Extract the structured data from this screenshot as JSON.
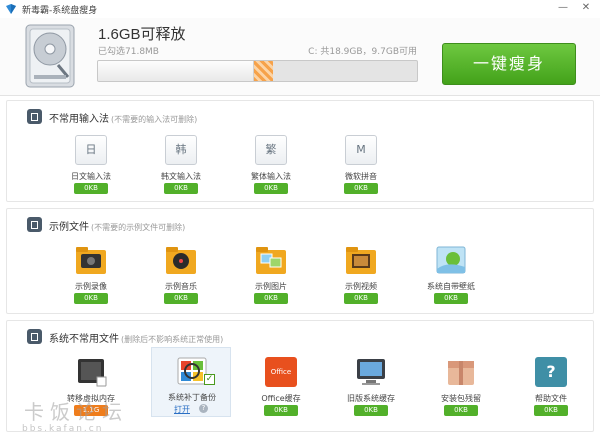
{
  "window": {
    "title": "新毒霸-系统盘瘦身",
    "minimize_icon": "minimize-icon",
    "close_icon": "close-icon"
  },
  "header": {
    "releasable": "1.6GB可释放",
    "selected": "已勾选71.8MB",
    "disk_info": "C: 共18.9GB，9.7GB可用",
    "usage_fraction": 0.49,
    "selected_fraction": 0.06,
    "clean_button": "一键瘦身",
    "colors": {
      "accent": "#4fae24",
      "progress": "#f6a24a"
    }
  },
  "sections": [
    {
      "title": "不常用输入法",
      "note": "(不需要的输入法可删除)",
      "items": [
        {
          "label": "日文输入法",
          "size": "0KB",
          "icon": "日"
        },
        {
          "label": "韩文输入法",
          "size": "0KB",
          "icon": "韩"
        },
        {
          "label": "繁体输入法",
          "size": "0KB",
          "icon": "繁"
        },
        {
          "label": "微软拼音",
          "size": "0KB",
          "icon": "M"
        }
      ]
    },
    {
      "title": "示例文件",
      "note": "(不需要的示例文件可删除)",
      "items": [
        {
          "label": "示例录像",
          "size": "0KB",
          "icon": "video-folder-icon"
        },
        {
          "label": "示例音乐",
          "size": "0KB",
          "icon": "music-folder-icon"
        },
        {
          "label": "示例图片",
          "size": "0KB",
          "icon": "picture-folder-icon"
        },
        {
          "label": "示例视频",
          "size": "0KB",
          "icon": "film-folder-icon"
        },
        {
          "label": "系统自带壁纸",
          "size": "0KB",
          "icon": "wallpaper-icon"
        }
      ]
    },
    {
      "title": "系统不常用文件",
      "note": "(删除后不影响系统正常使用)",
      "items": [
        {
          "label": "转移虚拟内存",
          "size": "1.1G",
          "icon": "memory-chip-icon"
        },
        {
          "label": "系统补丁备份",
          "size": "",
          "icon": "windows-update-icon",
          "link": "打开",
          "help": "?"
        },
        {
          "label": "Office缓存",
          "size": "0KB",
          "icon": "office-icon",
          "icon_text": "Office"
        },
        {
          "label": "旧版系统缓存",
          "size": "0KB",
          "icon": "monitor-icon"
        },
        {
          "label": "安装包残留",
          "size": "0KB",
          "icon": "package-box-icon"
        },
        {
          "label": "帮助文件",
          "size": "0KB",
          "icon": "help-file-icon",
          "icon_text": "?"
        }
      ]
    }
  ],
  "watermark": {
    "text": "卡饭论坛",
    "url": "bbs.kafan.cn"
  }
}
